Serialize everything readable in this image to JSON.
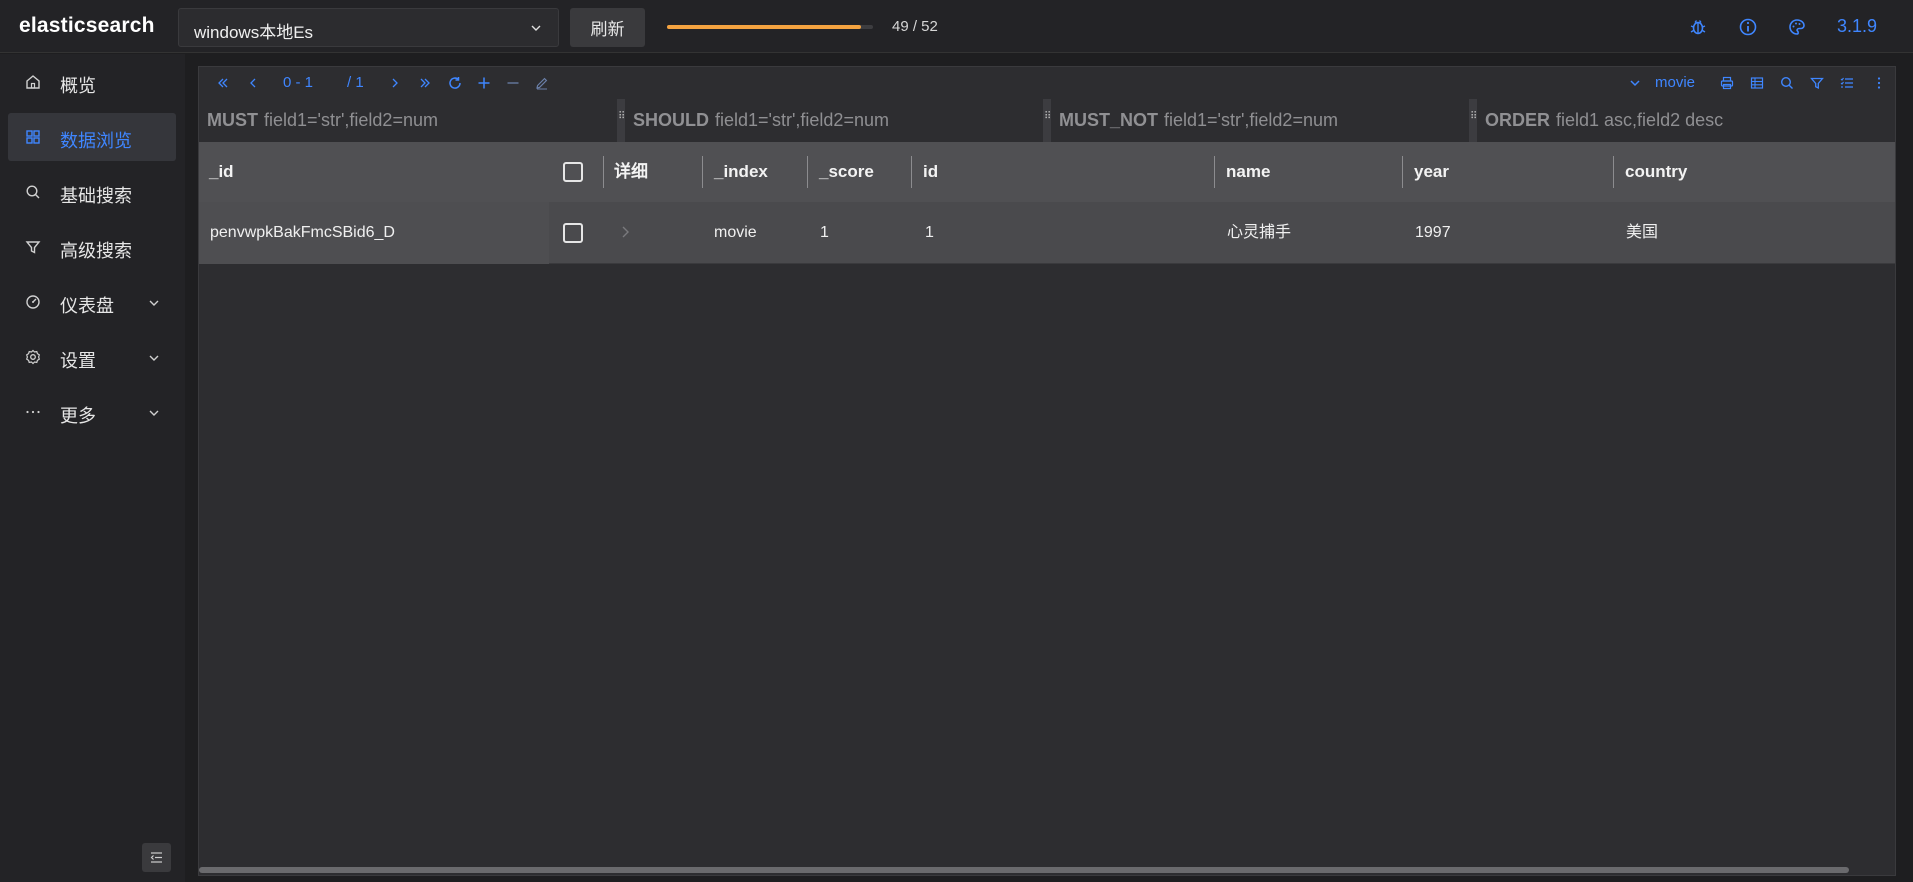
{
  "app": {
    "title": "elasticsearch",
    "version": "3.1.9"
  },
  "header": {
    "connection": "windows本地Es",
    "refresh_label": "刷新",
    "progress_text": "49 / 52",
    "progress_fraction": 0.942,
    "progress_color": "#f4a340",
    "icons": [
      "bug-icon",
      "info-icon",
      "palette-icon"
    ]
  },
  "sidebar": {
    "items": [
      {
        "label": "概览",
        "icon": "home-icon",
        "active": false,
        "expandable": false
      },
      {
        "label": "数据浏览",
        "icon": "grid-icon",
        "active": true,
        "expandable": false
      },
      {
        "label": "基础搜索",
        "icon": "search-icon",
        "active": false,
        "expandable": false
      },
      {
        "label": "高级搜索",
        "icon": "filter-icon",
        "active": false,
        "expandable": false
      },
      {
        "label": "仪表盘",
        "icon": "dashboard-icon",
        "active": false,
        "expandable": true
      },
      {
        "label": "设置",
        "icon": "gear-icon",
        "active": false,
        "expandable": true
      },
      {
        "label": "更多",
        "icon": "more-icon",
        "active": false,
        "expandable": true
      }
    ]
  },
  "toolbar": {
    "page_range": "0 - 1",
    "page_total": "/ 1",
    "index_name": "movie",
    "accent_color": "#3f86ff"
  },
  "filters": {
    "must": {
      "keyword": "MUST",
      "placeholder": "field1='str',field2=num"
    },
    "should": {
      "keyword": "SHOULD",
      "placeholder": "field1='str',field2=num"
    },
    "must_not": {
      "keyword": "MUST_NOT",
      "placeholder": "field1='str',field2=num"
    },
    "order": {
      "keyword": "ORDER",
      "placeholder": "field1 asc,field2 desc"
    }
  },
  "table": {
    "columns": [
      "_id",
      "详细",
      "_index",
      "_score",
      "id",
      "name",
      "year",
      "country"
    ],
    "rows": [
      {
        "_id": "penvwpkBakFmcSBid6_D",
        "_index": "movie",
        "_score": "1",
        "id": "1",
        "name": "心灵捕手",
        "year": "1997",
        "country": "美国"
      }
    ]
  }
}
